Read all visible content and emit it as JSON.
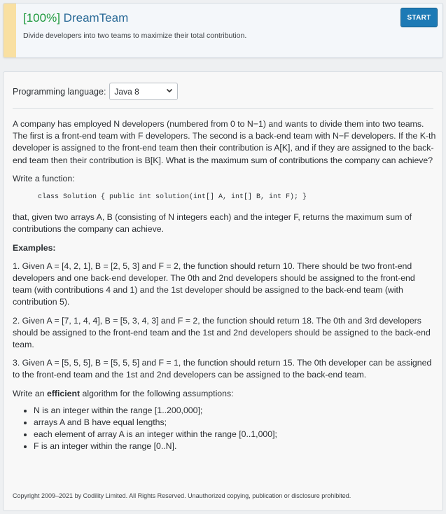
{
  "header": {
    "score": "[100%]",
    "task_name": "DreamTeam",
    "subtitle": "Divide developers into two teams to maximize their total contribution.",
    "start_label": "START"
  },
  "language": {
    "label": "Programming language:",
    "selected": "Java 8"
  },
  "statement": {
    "intro": "A company has employed N developers (numbered from 0 to N−1) and wants to divide them into two teams. The first is a front-end team with F developers. The second is a back-end team with N−F developers. If the K-th developer is assigned to the front-end team then their contribution is A[K], and if they are assigned to the back-end team then their contribution is B[K]. What is the maximum sum of contributions the company can achieve?",
    "write_function": "Write a function:",
    "signature": "class Solution { public int solution(int[] A, int[] B, int F); }",
    "given": "that, given two arrays A, B (consisting of N integers each) and the integer F, returns the maximum sum of contributions the company can achieve.",
    "examples_heading": "Examples:",
    "examples": [
      "1. Given A = [4, 2, 1], B = [2, 5, 3] and F = 2, the function should return 10. There should be two front-end developers and one back-end developer. The 0th and 2nd developers should be assigned to the front-end team (with contributions 4 and 1) and the 1st developer should be assigned to the back-end team (with contribution 5).",
      "2. Given A = [7, 1, 4, 4], B = [5, 3, 4, 3] and F = 2, the function should return 18. The 0th and 3rd developers should be assigned to the front-end team and the 1st and 2nd developers should be assigned to the back-end team.",
      "3. Given A = [5, 5, 5], B = [5, 5, 5] and F = 1, the function should return 15. The 0th developer can be assigned to the front-end team and the 1st and 2nd developers can be assigned to the back-end team."
    ],
    "efficient_pre": "Write an ",
    "efficient_word": "efficient",
    "efficient_post": " algorithm for the following assumptions:",
    "assumptions": [
      "N is an integer within the range [1..200,000];",
      "arrays A and B have equal lengths;",
      "each element of array A is an integer within the range [0..1,000];",
      "F is an integer within the range [0..N]."
    ]
  },
  "footer": {
    "copyright": "Copyright 2009–2021 by Codility Limited. All Rights Reserved. Unauthorized copying, publication or disclosure prohibited."
  },
  "colors": {
    "accent_bar": "#f9e0a2",
    "title_blue": "#2a6a97",
    "score_green": "#1f9a3e",
    "start_button": "#1d7ab5"
  }
}
